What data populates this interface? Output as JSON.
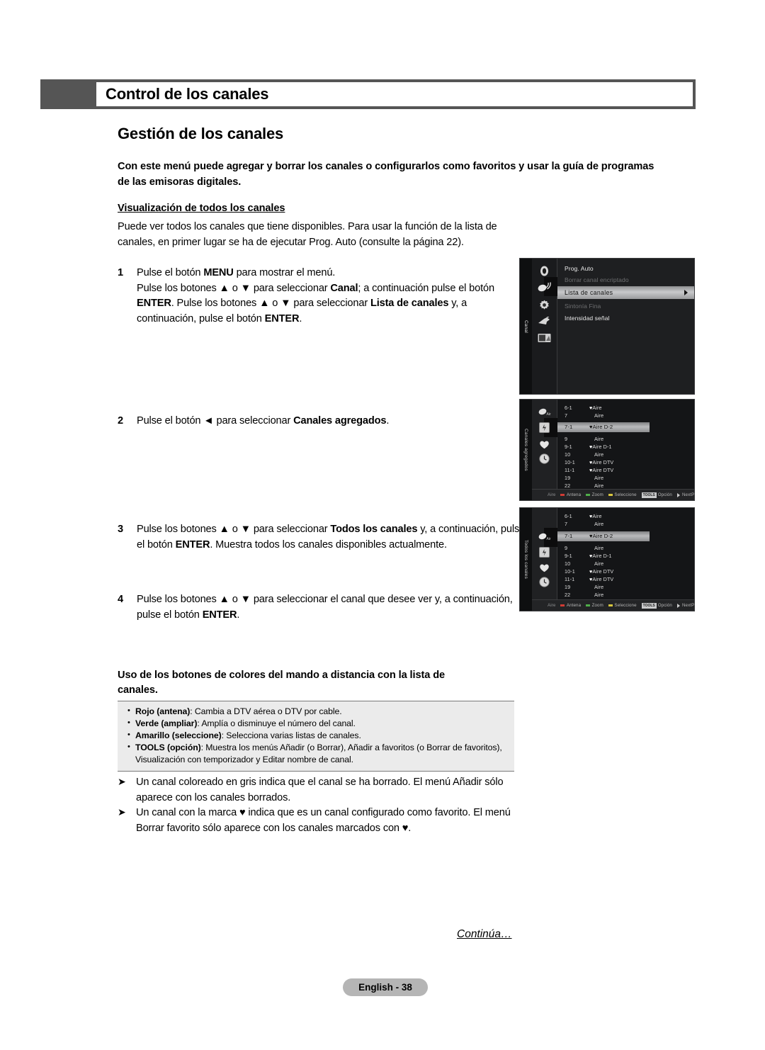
{
  "header": {
    "title": "Control de los canales"
  },
  "section": {
    "heading": "Gestión de los canales",
    "intro": "Con este menú puede agregar y borrar los canales o configurarlos como favoritos y usar la guía de programas de las emisoras digitales.",
    "subheading": "Visualización de todos los canales",
    "paragraph": "Puede ver todos los canales que tiene disponibles. Para usar la función de la lista de canales, en primer lugar se ha de ejecutar Prog. Auto (consulte la página 22)."
  },
  "steps": [
    {
      "num": "1",
      "text_html": "Pulse el botón <b>MENU</b> para mostrar el menú.<br>Pulse los botones ▲ o ▼ para seleccionar <b>Canal</b>; a continuación pulse el botón <b>ENTER</b>. Pulse los botones ▲ o ▼ para seleccionar <b>Lista de canales</b> y, a continuación, pulse el botón <b>ENTER</b>."
    },
    {
      "num": "2",
      "text_html": "Pulse el botón ◄ para seleccionar <b>Canales agregados</b>."
    },
    {
      "num": "3",
      "text_html": "Pulse los botones ▲ o ▼ para seleccionar <b>Todos los canales</b> y, a continuación, pulse el botón <b>ENTER</b>. Muestra todos los canales disponibles actualmente."
    },
    {
      "num": "4",
      "text_html": "Pulse los botones ▲ o ▼ para seleccionar el canal que desee ver y, a continuación, pulse el botón <b>ENTER</b>."
    }
  ],
  "color_buttons": {
    "heading": "Uso de los botones de colores del mando a distancia con la lista de canales.",
    "items": [
      "<b>Rojo (antena)</b>: Cambia a DTV aérea o DTV por cable.",
      "<b>Verde (ampliar)</b>: Amplía o disminuye el número del canal.",
      "<b>Amarillo (seleccione)</b>: Selecciona varias listas de canales.",
      "<b>TOOLS (opción)</b>: Muestra los menús Añadir (o Borrar), Añadir a favoritos (o Borrar de favoritos), Visualización con temporizador y Editar nombre de canal."
    ]
  },
  "notes": [
    "Un canal coloreado en gris indica que el canal se ha borrado. El menú Añadir sólo aparece con los canales borrados.",
    "Un canal con la marca ♥ indica que es un canal configurado como favorito. El menú Borrar favorito sólo aparece con los canales marcados con ♥."
  ],
  "footer": {
    "continued": "Continúa…",
    "page": "English - 38"
  },
  "tv_menu": {
    "tab_label": "Canal",
    "items": [
      {
        "label": "Prog. Auto",
        "state": "normal"
      },
      {
        "label": "Borrar canal encriptado",
        "state": "dim"
      },
      {
        "label": "Lista de canales",
        "state": "selected"
      },
      {
        "label": "Sintonía Fina",
        "state": "dim"
      },
      {
        "label": "Intensidad señal",
        "state": "normal"
      }
    ],
    "icons": [
      "tv-icon",
      "antenna-signal-icon",
      "gear-icon",
      "plug-icon",
      "picture-icon"
    ]
  },
  "tv_added": {
    "tab_label": "Canales agregados",
    "icons": [
      "antenna-icon",
      "add-channel-icon",
      "heart-icon",
      "clock-icon"
    ],
    "selected_icon_index": 1,
    "channels": [
      {
        "no": "6-1",
        "fav": "♥",
        "name": "Aire"
      },
      {
        "no": "7",
        "fav": "",
        "name": "Aire"
      },
      {
        "no": "7-1",
        "fav": "♥",
        "name": "Aire D-2",
        "selected": true
      },
      {
        "no": "9",
        "fav": "",
        "name": "Aire"
      },
      {
        "no": "9-1",
        "fav": "♥",
        "name": "Aire D-1"
      },
      {
        "no": "10",
        "fav": "",
        "name": "Aire"
      },
      {
        "no": "10-1",
        "fav": "♥",
        "name": "Aire DTV"
      },
      {
        "no": "11-1",
        "fav": "♥",
        "name": "Aire DTV"
      },
      {
        "no": "19",
        "fav": "",
        "name": "Aire"
      },
      {
        "no": "22",
        "fav": "",
        "name": "Aire"
      }
    ],
    "bottom_bar": {
      "source": "Aire",
      "red": "Antena",
      "green": "Zoom",
      "yellow": "Seleccione",
      "tools_badge": "TOOLS",
      "tools": "Opción",
      "next": "NextProgram"
    }
  },
  "tv_all": {
    "tab_label": "Todos los canales",
    "icons": [
      "antenna-icon",
      "add-channel-icon",
      "heart-icon",
      "clock-icon"
    ],
    "selected_icon_index": 0,
    "channels": [
      {
        "no": "6-1",
        "fav": "♥",
        "name": "Aire"
      },
      {
        "no": "7",
        "fav": "",
        "name": "Aire"
      },
      {
        "no": "7-1",
        "fav": "♥",
        "name": "Aire D-2",
        "selected": true
      },
      {
        "no": "9",
        "fav": "",
        "name": "Aire"
      },
      {
        "no": "9-1",
        "fav": "♥",
        "name": "Aire D-1"
      },
      {
        "no": "10",
        "fav": "",
        "name": "Aire"
      },
      {
        "no": "10-1",
        "fav": "♥",
        "name": "Aire DTV"
      },
      {
        "no": "11-1",
        "fav": "♥",
        "name": "Aire DTV"
      },
      {
        "no": "19",
        "fav": "",
        "name": "Aire"
      },
      {
        "no": "22",
        "fav": "",
        "name": "Aire"
      }
    ],
    "bottom_bar": {
      "source": "Aire",
      "red": "Antena",
      "green": "Zoom",
      "yellow": "Seleccione",
      "tools_badge": "TOOLS",
      "tools": "Opción",
      "next": "NextProgram"
    }
  }
}
